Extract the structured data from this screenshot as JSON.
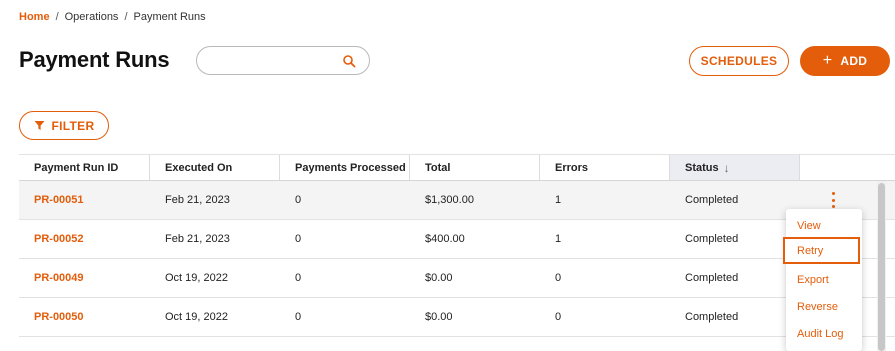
{
  "breadcrumb": {
    "home": "Home",
    "sep1": "/",
    "level1": "Operations",
    "sep2": "/",
    "level2": "Payment Runs"
  },
  "page": {
    "title": "Payment Runs"
  },
  "search": {
    "value": "",
    "placeholder": "",
    "icon": "search-icon"
  },
  "toolbar": {
    "schedules_label": "SCHEDULES",
    "add_label": "ADD",
    "add_icon": "+",
    "filter_label": "FILTER"
  },
  "colors": {
    "accent": "#e35d0b",
    "sorted_header_bg": "#ececf3"
  },
  "table": {
    "headers": [
      "Payment Run ID",
      "Executed On",
      "Payments Processed",
      "Total",
      "Errors",
      "Status"
    ],
    "sort_arrow": "↓",
    "rows": [
      {
        "id": "PR-00051",
        "executed": "Feb 21, 2023",
        "processed": "0",
        "total": "$1,300.00",
        "errors": "1",
        "status": "Completed"
      },
      {
        "id": "PR-00052",
        "executed": "Feb 21, 2023",
        "processed": "0",
        "total": "$400.00",
        "errors": "1",
        "status": "Completed"
      },
      {
        "id": "PR-00049",
        "executed": "Oct 19, 2022",
        "processed": "0",
        "total": "$0.00",
        "errors": "0",
        "status": "Completed"
      },
      {
        "id": "PR-00050",
        "executed": "Oct 19, 2022",
        "processed": "0",
        "total": "$0.00",
        "errors": "0",
        "status": "Completed"
      }
    ]
  },
  "row_menu": {
    "items": [
      "View",
      "Retry",
      "Export",
      "Reverse",
      "Audit Log"
    ],
    "active": "Retry"
  }
}
